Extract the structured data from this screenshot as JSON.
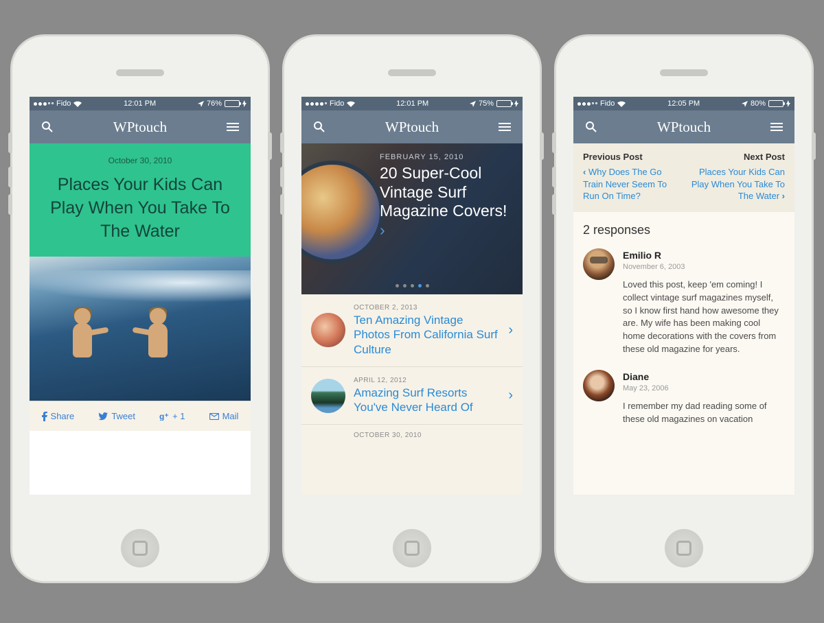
{
  "phones": [
    {
      "status": {
        "carrier": "Fido",
        "time": "12:01 PM",
        "battery_pct": "76%"
      },
      "app_title": "WPtouch",
      "hero": {
        "date": "October 30, 2010",
        "title": "Places Your Kids Can Play When You Take To The Water"
      },
      "share": {
        "fb": "Share",
        "tw": "Tweet",
        "gp": "+ 1",
        "mail": "Mail"
      }
    },
    {
      "status": {
        "carrier": "Fido",
        "time": "12:01 PM",
        "battery_pct": "75%"
      },
      "app_title": "WPtouch",
      "carousel": {
        "date": "FEBRUARY 15, 2010",
        "title": "20 Super-Cool Vintage Surf Magazine Covers!"
      },
      "posts": [
        {
          "date": "OCTOBER 2, 2013",
          "title": "Ten Amazing Vintage Photos From California Surf Culture"
        },
        {
          "date": "APRIL 12, 2012",
          "title": "Amazing Surf Resorts You've Never Heard Of"
        },
        {
          "date": "OCTOBER 30, 2010",
          "title": ""
        }
      ]
    },
    {
      "status": {
        "carrier": "Fido",
        "time": "12:05 PM",
        "battery_pct": "80%"
      },
      "app_title": "WPtouch",
      "nav": {
        "prev_label": "Previous Post",
        "next_label": "Next Post",
        "prev_link": "Why Does The Go Train Never Seem To Run On Time?",
        "next_link": "Places Your Kids Can Play When You Take To The Water"
      },
      "responses_title": "2 responses",
      "comments": [
        {
          "name": "Emilio R",
          "date": "November 6, 2003",
          "text": "Loved this post, keep 'em coming! I collect vintage surf magazines myself, so I know first hand how awesome they are. My wife has been making cool home decorations with the covers from these old magazine for years."
        },
        {
          "name": "Diane",
          "date": "May 23, 2006",
          "text": "I remember my dad reading some of these old magazines on vacation"
        }
      ]
    }
  ]
}
